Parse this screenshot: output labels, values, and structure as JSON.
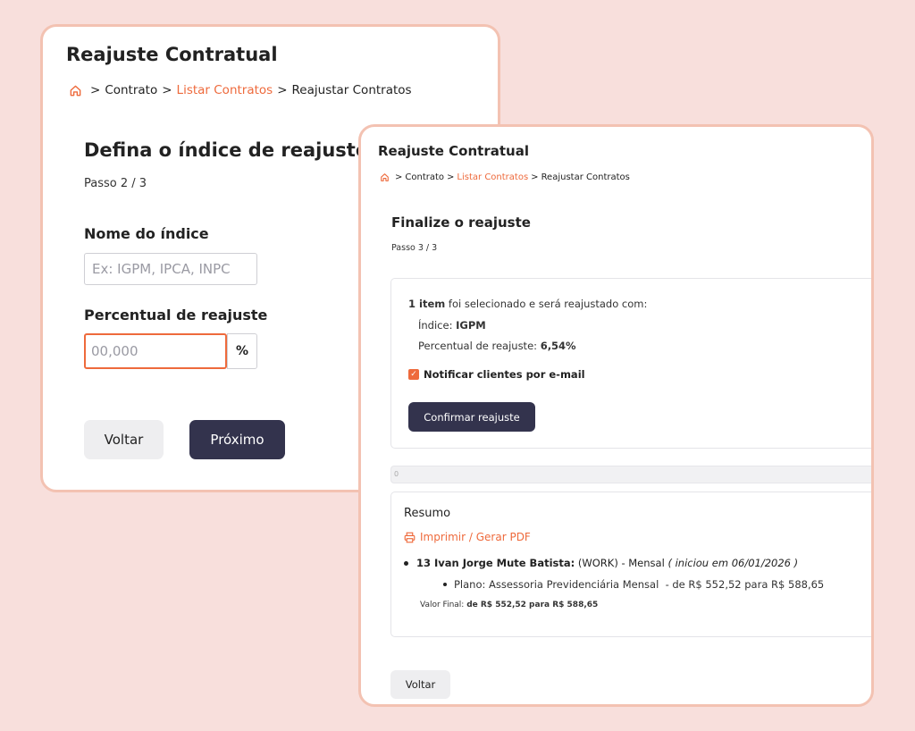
{
  "colors": {
    "background": "#f8dfdc",
    "card_border": "#f3c2b2",
    "accent": "#ee6a3c",
    "primary_button": "#33334d",
    "secondary_button": "#eeeef0"
  },
  "step2": {
    "title": "Reajuste Contratual",
    "breadcrumb": {
      "home_icon": "home-icon",
      "items": [
        "Contrato",
        "Listar Contratos",
        "Reajustar Contratos"
      ],
      "separator": ">"
    },
    "heading": "Defina o índice de reajuste",
    "step": "Passo 2 / 3",
    "index_name": {
      "label": "Nome do índice",
      "placeholder": "Ex: IGPM, IPCA, INPC",
      "value": ""
    },
    "percentage": {
      "label": "Percentual de reajuste",
      "placeholder": "00,000",
      "value": "",
      "suffix": "%"
    },
    "back_label": "Voltar",
    "next_label": "Próximo"
  },
  "step3": {
    "title": "Reajuste Contratual",
    "breadcrumb": {
      "home_icon": "home-icon",
      "items": [
        "Contrato",
        "Listar Contratos",
        "Reajustar Contratos"
      ],
      "separator": ">"
    },
    "heading": "Finalize o reajuste",
    "step": "Passo 3 / 3",
    "selection_count": "1 item",
    "selection_text": " foi selecionado e será reajustado com:",
    "index_label": "Índice: ",
    "index_value": "IGPM",
    "percent_label": "Percentual de reajuste: ",
    "percent_value": "6,54%",
    "notify_checked": true,
    "notify_label": "Notificar clientes por e-mail",
    "confirm_label": "Confirmar reajuste",
    "progress_value": "0",
    "summary": {
      "title": "Resumo",
      "print_label": "Imprimir / Gerar PDF",
      "client_name": "13 Ivan Jorge Mute Batista:",
      "client_detail": " (WORK) - Mensal ",
      "client_started": "( iniciou em 06/01/2026 )",
      "plan_line": "Plano: Assessoria Previdenciária Mensal  - de R$ 552,52 para R$ 588,65",
      "final_label": "Valor Final: ",
      "final_value": "de R$ 552,52 para R$ 588,65"
    },
    "back_label": "Voltar"
  }
}
